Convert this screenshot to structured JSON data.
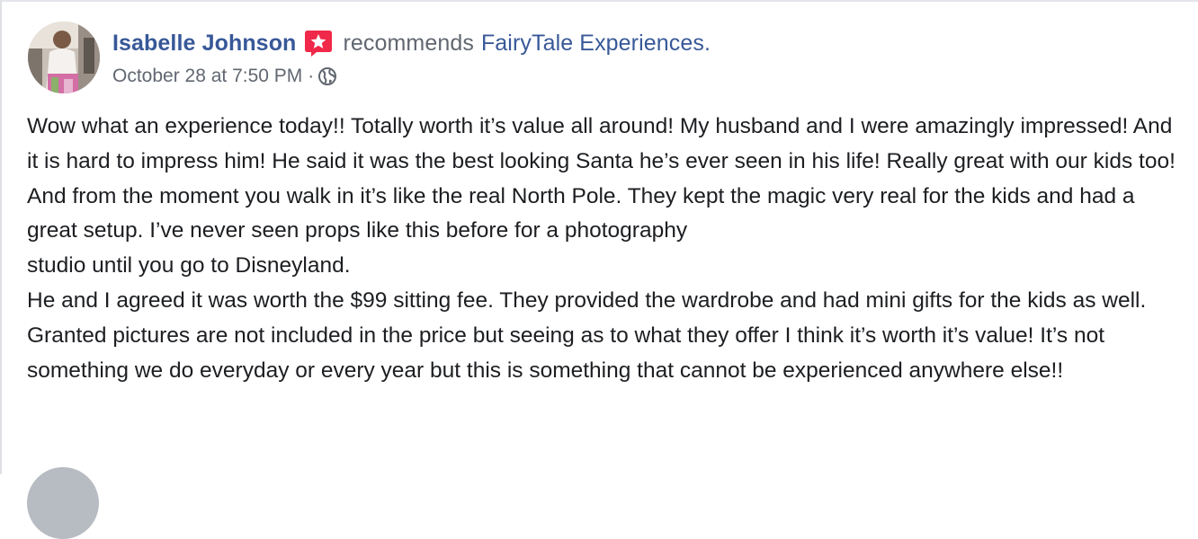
{
  "post": {
    "author_name": "Isabelle Johnson",
    "action_text": "recommends",
    "page_name": "FairyTale Experiences.",
    "timestamp": "October 28 at 7:50 PM",
    "separator": "·",
    "audience_icon": "globe-icon",
    "badge_icon": "recommendation-star-icon",
    "body_paragraphs": [
      "Wow what an experience today!! Totally worth it’s value all around! My husband and I were amazingly impressed! And it is hard to impress him! He said it was the best looking Santa he’s ever seen in his life! Really great with our kids too! And from the moment you walk in it’s like the real North Pole. They kept the magic very real for the kids and had a great setup. I’ve never seen props like this before for a photography",
      "studio until you go to Disneyland.",
      "He and I agreed it was worth the $99 sitting fee. They provided the wardrobe and had mini gifts for the kids as well. Granted pictures are not included in the price but seeing as to what they offer I think it’s worth it’s value! It’s not something we do everyday or every year but this is something that cannot be experienced anywhere else!!"
    ]
  },
  "colors": {
    "link_blue": "#385898",
    "meta_gray": "#616770",
    "text": "#1c1e21",
    "badge_red": "#f02849"
  }
}
